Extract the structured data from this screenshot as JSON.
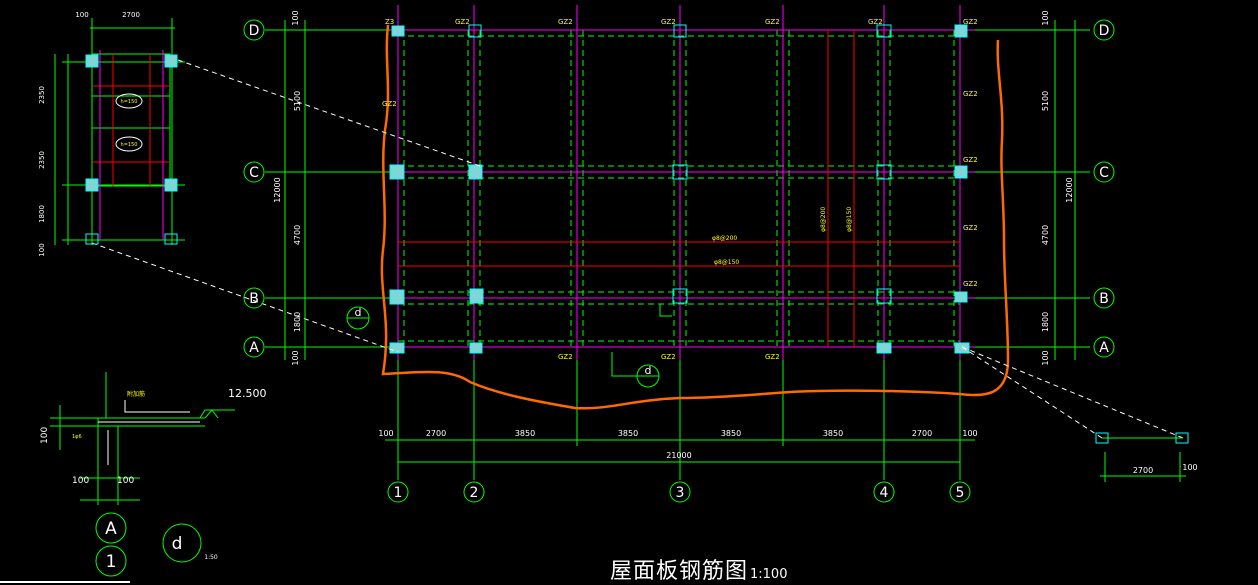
{
  "drawing": {
    "title": "屋面板钢筋图",
    "scale": "1:100",
    "colors": {
      "background": "#000000",
      "grid": "#00ff00",
      "beam_dashed": "#00ff00",
      "column_fill": "#7fd6d6",
      "axis_magenta": "#ff00ff",
      "rebar_red": "#ff0000",
      "note_yellow": "#ffff00",
      "cloud_orange": "#ff6a00",
      "dim_white": "#ffffff"
    }
  },
  "axes": {
    "rows": [
      "D",
      "C",
      "B",
      "A"
    ],
    "columns": [
      "1",
      "2",
      "3",
      "4",
      "5"
    ]
  },
  "dimensions": {
    "bottom_spans": [
      "2700",
      "3850",
      "3850",
      "3850",
      "3850",
      "2700"
    ],
    "bottom_edges": [
      "100",
      "100"
    ],
    "bottom_total": "21000",
    "left_spans": [
      "5100",
      "4700",
      "1800"
    ],
    "left_edges": [
      "100",
      "100"
    ],
    "left_total": "12000",
    "right_spans": [
      "5100",
      "4700",
      "1800"
    ],
    "right_edges": [
      "100",
      "100"
    ],
    "right_total": "12000"
  },
  "beam_labels": [
    "GZ2",
    "GZ2",
    "GZ2",
    "GZ2",
    "GZ2",
    "GZ2",
    "GZ2",
    "GZ2",
    "GZ2",
    "GZ2",
    "GZ2",
    "GZ2",
    "GZ2",
    "GZ2"
  ],
  "column_tag": "Z3",
  "rebar_notes": {
    "horizontal_1": "φ8@200",
    "horizontal_2": "φ8@150",
    "vertical_1": "φ8@200",
    "vertical_2": "φ8@150"
  },
  "section_mark": "d",
  "detail_plan": {
    "width": "2700",
    "edge": "100",
    "heights": [
      "2350",
      "2350",
      "1800"
    ],
    "bottom_edge": "100",
    "slab_notes": [
      "h=150",
      "h=150"
    ],
    "zoom_width": "2700",
    "zoom_edge": "100"
  },
  "section_detail": {
    "elevation": "12.500",
    "note": "附加筋",
    "dims": [
      "100",
      "100",
      "100"
    ],
    "small": "1φ6"
  },
  "legend": {
    "bubble_axis": "A",
    "bubble_number": "1",
    "bubble_section": "d",
    "section_scale": "1:50"
  }
}
